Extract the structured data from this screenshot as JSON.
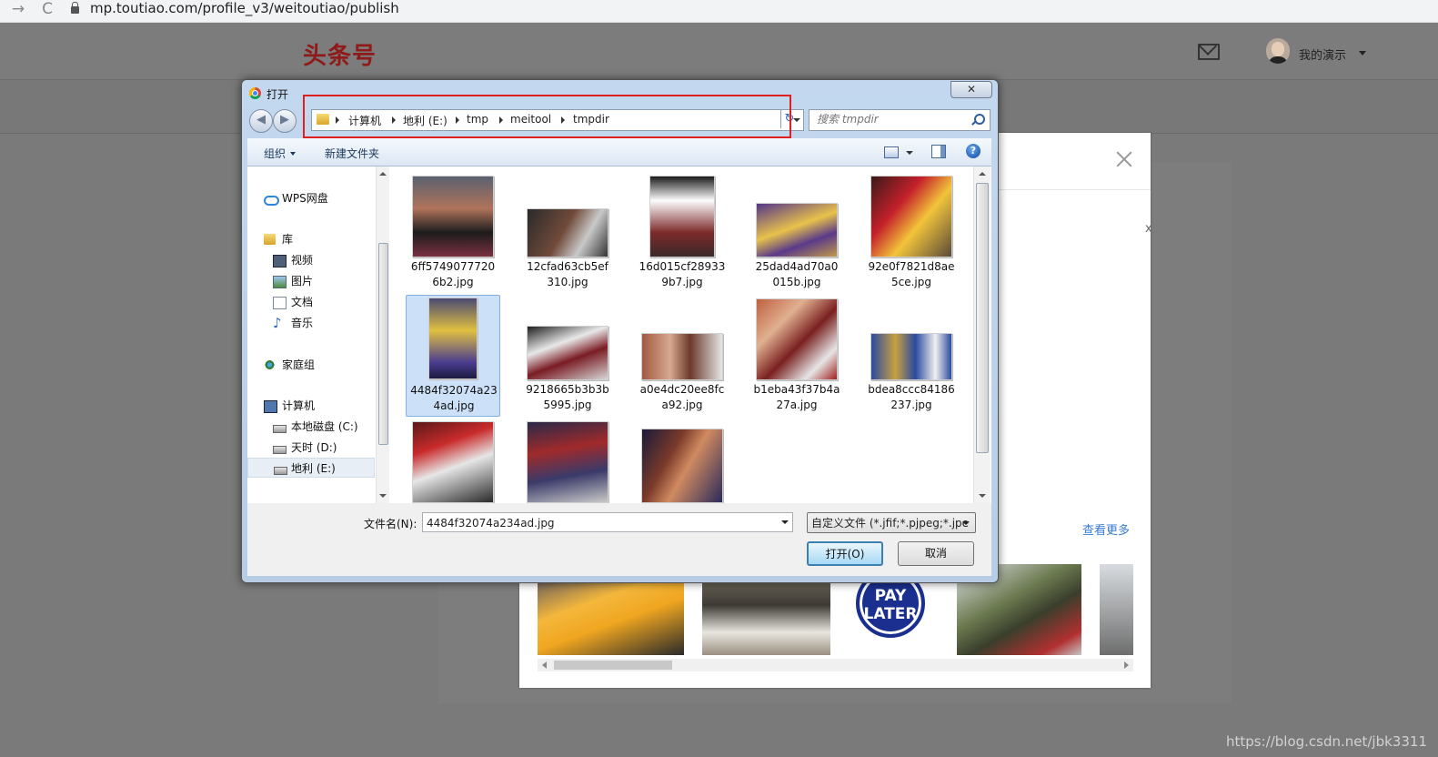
{
  "browser": {
    "url": "mp.toutiao.com/profile_v3/weitoutiao/publish",
    "back_glyph": "→",
    "reload_glyph": "C"
  },
  "site": {
    "logo": "头条号",
    "user_name": "我的演示"
  },
  "background_modal": {
    "hint_char": "x",
    "see_more": "查看更多",
    "pay_later": "PAY\nLATER"
  },
  "dialog": {
    "title": "打开",
    "close_glyph": "✕",
    "back_glyph": "◀",
    "forward_glyph": "▶",
    "refresh_glyph": "↻",
    "breadcrumb": [
      "计算机",
      "地利 (E:)",
      "tmp",
      "meitool",
      "tmpdir"
    ],
    "search_placeholder": "搜索 tmpdir",
    "toolbar": {
      "organize": "组织",
      "new_folder": "新建文件夹",
      "help_glyph": "?"
    },
    "sidebar": [
      {
        "label": "WPS网盘",
        "icon": "cloud-icon",
        "indent": 0
      },
      {
        "label": "库",
        "icon": "library-icon",
        "indent": 0
      },
      {
        "label": "视频",
        "icon": "video-icon",
        "indent": 1
      },
      {
        "label": "图片",
        "icon": "picture-icon",
        "indent": 1
      },
      {
        "label": "文档",
        "icon": "document-icon",
        "indent": 1
      },
      {
        "label": "音乐",
        "icon": "music-icon",
        "indent": 1
      },
      {
        "label": "家庭组",
        "icon": "homegroup-icon",
        "indent": 0
      },
      {
        "label": "计算机",
        "icon": "computer-icon",
        "indent": 0
      },
      {
        "label": "本地磁盘 (C:)",
        "icon": "drive-icon",
        "indent": 1
      },
      {
        "label": "天时 (D:)",
        "icon": "drive-icon",
        "indent": 1
      },
      {
        "label": "地利 (E:)",
        "icon": "drive-icon",
        "indent": 1,
        "selected": true
      }
    ],
    "files": [
      {
        "name": "6ff57490777206b2.jpg"
      },
      {
        "name": "12cfad63cb5ef310.jpg"
      },
      {
        "name": "16d015cf289339b7.jpg"
      },
      {
        "name": "25dad4ad70a0015b.jpg"
      },
      {
        "name": "92e0f7821d8ae5ce.jpg"
      },
      {
        "name": "4484f32074a234ad.jpg",
        "selected": true
      },
      {
        "name": "9218665b3b3b5995.jpg"
      },
      {
        "name": "a0e4dc20ee8fca92.jpg"
      },
      {
        "name": "b1eba43f37b4a27a.jpg"
      },
      {
        "name": "bdea8ccc84186237.jpg"
      },
      {
        "name": ""
      },
      {
        "name": ""
      },
      {
        "name": ""
      }
    ],
    "filename_label": "文件名(N):",
    "filename_value": "4484f32074a234ad.jpg",
    "filetype": "自定义文件 (*.jfif;*.pjpeg;*.jpe",
    "open_button": "打开(O)",
    "cancel_button": "取消"
  },
  "watermark": "https://blog.csdn.net/jbk3311"
}
